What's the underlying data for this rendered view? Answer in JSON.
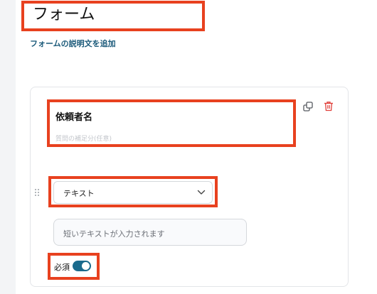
{
  "form": {
    "title": "フォーム",
    "add_description_link": "フォームの説明文を追加"
  },
  "question": {
    "title": "依頼者名",
    "supplement_placeholder": "質問の補足分(任意)",
    "type_select": {
      "selected": "テキスト"
    },
    "answer_placeholder": "短いテキストが入力されます",
    "required_label": "必須",
    "required": true
  },
  "icons": {
    "copy": "copy-icon",
    "delete": "trash-icon",
    "drag": "drag-handle-icon",
    "dropdown": "chevron-down-icon"
  },
  "colors": {
    "highlight": "#e8411f",
    "link": "#1b5a7a",
    "toggle_on": "#1a6a8c",
    "delete_icon": "#e0413c"
  }
}
